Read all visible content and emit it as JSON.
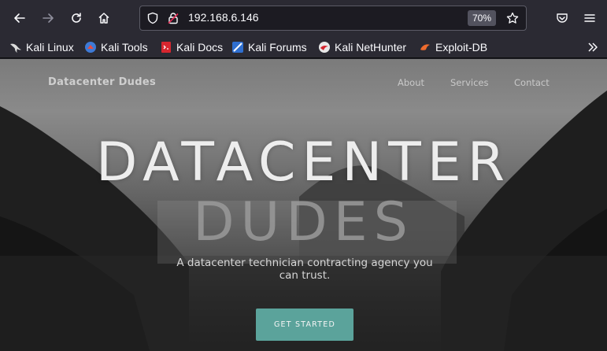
{
  "browser": {
    "url": "192.168.6.146",
    "zoom": "70%"
  },
  "bookmarks": [
    {
      "label": "Kali Linux",
      "icon": "kali-dragon-icon"
    },
    {
      "label": "Kali Tools",
      "icon": "kali-tools-icon"
    },
    {
      "label": "Kali Docs",
      "icon": "kali-docs-icon"
    },
    {
      "label": "Kali Forums",
      "icon": "kali-forums-icon"
    },
    {
      "label": "Kali NetHunter",
      "icon": "kali-nethunter-icon"
    },
    {
      "label": "Exploit-DB",
      "icon": "exploit-db-icon"
    }
  ],
  "site": {
    "brand": "Datacenter Dudes",
    "nav": [
      "About",
      "Services",
      "Contact"
    ],
    "hero_title": "DATACENTER",
    "hero_subtitle": "DUDES",
    "tagline": "A datacenter technician contracting agency you can trust.",
    "cta": "GET STARTED"
  },
  "colors": {
    "toolbar": "#2b2a33",
    "cta": "#5ba39b"
  }
}
